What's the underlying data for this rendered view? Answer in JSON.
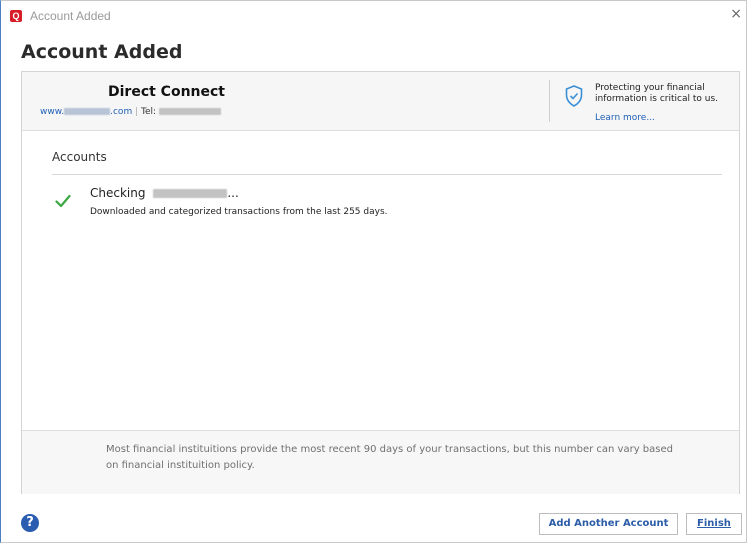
{
  "window": {
    "title": "Account Added",
    "close_glyph": "×"
  },
  "app_logo": {
    "letter": "Q",
    "color": "#d71e28"
  },
  "page": {
    "title": "Account Added"
  },
  "institution": {
    "name": "Direct Connect",
    "url_prefix": "www.",
    "url_suffix": ".com",
    "tel_label": "Tel:",
    "security_line1": "Protecting your financial",
    "security_line2": "information is critical to us.",
    "learn_more": "Learn more..."
  },
  "accounts": {
    "heading": "Accounts",
    "items": [
      {
        "name": "Checking",
        "name_suffix": "...",
        "detail": "Downloaded and categorized transactions from the last 255 days.",
        "status_icon": "check-icon"
      }
    ]
  },
  "footer": {
    "note": "Most financial instituitions provide the most recent 90 days of your transactions, but this number can vary based on financial instituition policy."
  },
  "buttons": {
    "add_another": "Add Another Account",
    "finish": "Finish"
  },
  "help": {
    "glyph": "?"
  },
  "colors": {
    "accent": "#2b5da8",
    "link": "#2060b8",
    "check": "#3aa843",
    "shield": "#3a8fd6"
  }
}
